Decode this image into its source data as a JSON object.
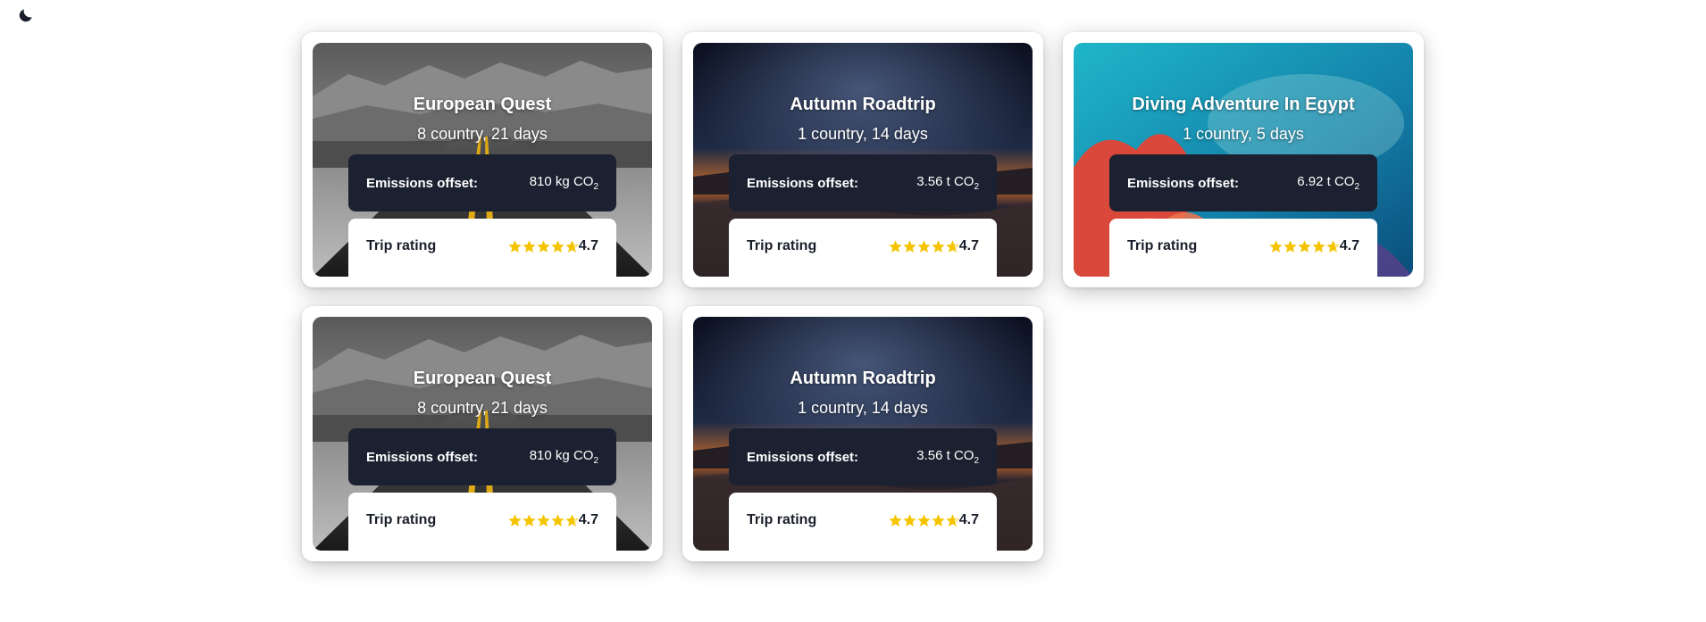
{
  "header": {
    "theme_toggle_icon": "moon-icon"
  },
  "colors": {
    "card_bg": "#ffffff",
    "panel_dark": "#1b2130",
    "star": "#f5c400",
    "text_dark": "#1a1f2b"
  },
  "labels": {
    "emissions": "Emissions offset:",
    "rating": "Trip rating",
    "co2_unit": "CO",
    "co2_sub": "2"
  },
  "trips": [
    {
      "title": "European Quest",
      "subtitle": "8 country, 21 days",
      "emissions_value": "810 kg",
      "rating": "4.7",
      "rating_value": 4.7,
      "image": "desert-road"
    },
    {
      "title": "Autumn Roadtrip",
      "subtitle": "1 country, 14 days",
      "emissions_value": "3.56 t",
      "rating": "4.7",
      "rating_value": 4.7,
      "image": "night-desert"
    },
    {
      "title": "Diving Adventure In Egypt",
      "subtitle": "1 country, 5 days",
      "emissions_value": "6.92 t",
      "rating": "4.7",
      "rating_value": 4.7,
      "image": "coral-reef"
    },
    {
      "title": "European Quest",
      "subtitle": "8 country, 21 days",
      "emissions_value": "810 kg",
      "rating": "4.7",
      "rating_value": 4.7,
      "image": "desert-road"
    },
    {
      "title": "Autumn Roadtrip",
      "subtitle": "1 country, 14 days",
      "emissions_value": "3.56 t",
      "rating": "4.7",
      "rating_value": 4.7,
      "image": "night-desert"
    }
  ]
}
